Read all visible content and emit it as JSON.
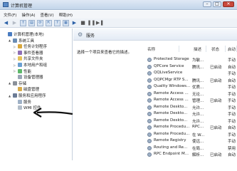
{
  "window": {
    "title": "计算机管理"
  },
  "menu": [
    "文件(F)",
    "操作(A)",
    "查看(V)",
    "帮助(H)"
  ],
  "toolbar": {
    "icons": [
      "back-icon",
      "forward-icon",
      "up-icon",
      "console-icon",
      "refresh-icon",
      "export-icon",
      "help-icon",
      "properties-icon",
      "play-icon",
      "stop-icon",
      "pause-icon",
      "restart-icon"
    ]
  },
  "tree": [
    {
      "label": "计算机管理(本地)",
      "level": 0,
      "expand": ""
    },
    {
      "label": "系统工具",
      "level": 1,
      "expand": "▲"
    },
    {
      "label": "任务计划程序",
      "level": 2,
      "expand": "▷"
    },
    {
      "label": "事件查看器",
      "level": 2,
      "expand": "▷"
    },
    {
      "label": "共享文件夹",
      "level": 2,
      "expand": "▷"
    },
    {
      "label": "本地用户和组",
      "level": 2,
      "expand": "▷"
    },
    {
      "label": "性能",
      "level": 2,
      "expand": "▷"
    },
    {
      "label": "设备管理器",
      "level": 2,
      "expand": ""
    },
    {
      "label": "存储",
      "level": 1,
      "expand": "▲"
    },
    {
      "label": "磁盘管理",
      "level": 2,
      "expand": ""
    },
    {
      "label": "服务和应用程序",
      "level": 1,
      "expand": "▲"
    },
    {
      "label": "服务",
      "level": 2,
      "expand": ""
    },
    {
      "label": "WMI 控件",
      "level": 2,
      "expand": ""
    }
  ],
  "services_panel": {
    "title": "服务",
    "description": "选择一个项目来查看它的描述。"
  },
  "columns": [
    "名称",
    "描述",
    "状态",
    "启动"
  ],
  "services": [
    {
      "name": "Protected Storage",
      "desc": "为敏...",
      "status": "",
      "startup": "手动"
    },
    {
      "name": "QPCore Service",
      "desc": "腾讯...",
      "status": "已启动",
      "startup": "自动"
    },
    {
      "name": "QQLiveService",
      "desc": "",
      "status": "",
      "startup": "手动"
    },
    {
      "name": "QQPCMgr RTP S...",
      "desc": "腾讯...",
      "status": "已启动",
      "startup": "自动"
    },
    {
      "name": "Quality Windows...",
      "desc": "优质...",
      "status": "",
      "startup": "手动"
    },
    {
      "name": "Remote Access ...",
      "desc": "无论...",
      "status": "",
      "startup": "手动"
    },
    {
      "name": "Remote Access ...",
      "desc": "管理...",
      "status": "已启动",
      "startup": "手动"
    },
    {
      "name": "Remote Deskto...",
      "desc": "允许...",
      "status": "",
      "startup": "手动"
    },
    {
      "name": "Remote Deskto...",
      "desc": "允许...",
      "status": "",
      "startup": "手动"
    },
    {
      "name": "Remote Deskto...",
      "desc": "允许...",
      "status": "",
      "startup": "手动"
    },
    {
      "name": "Remote Procedu...",
      "desc": "RPC...",
      "status": "已启动",
      "startup": "自动"
    },
    {
      "name": "Remote Procedu...",
      "desc": "在 W...",
      "status": "",
      "startup": "手动"
    },
    {
      "name": "Remote Registry",
      "desc": "使远...",
      "status": "",
      "startup": "手动"
    },
    {
      "name": "Routing and Re...",
      "desc": "在局...",
      "status": "",
      "startup": "禁用"
    },
    {
      "name": "RPC Endpoint M...",
      "desc": "解析...",
      "status": "已启动",
      "startup": "自动"
    }
  ]
}
